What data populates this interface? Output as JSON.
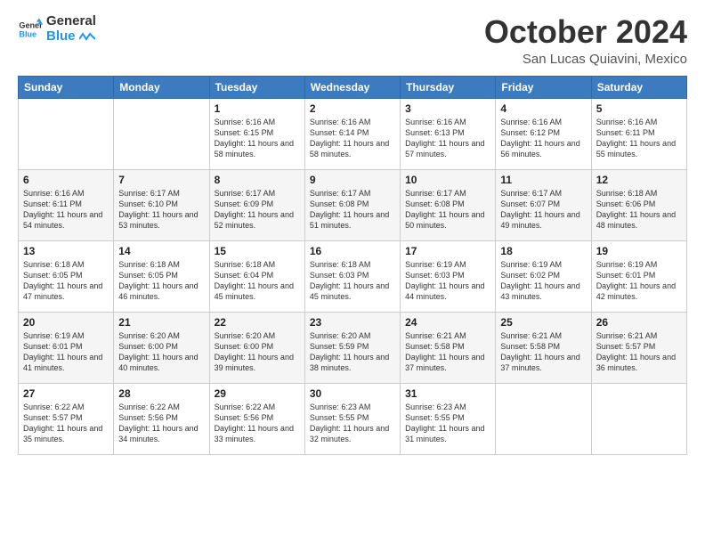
{
  "logo": {
    "text_general": "General",
    "text_blue": "Blue"
  },
  "header": {
    "month": "October 2024",
    "location": "San Lucas Quiavini, Mexico"
  },
  "weekdays": [
    "Sunday",
    "Monday",
    "Tuesday",
    "Wednesday",
    "Thursday",
    "Friday",
    "Saturday"
  ],
  "weeks": [
    [
      {
        "day": "",
        "info": ""
      },
      {
        "day": "",
        "info": ""
      },
      {
        "day": "1",
        "info": "Sunrise: 6:16 AM\nSunset: 6:15 PM\nDaylight: 11 hours and 58 minutes."
      },
      {
        "day": "2",
        "info": "Sunrise: 6:16 AM\nSunset: 6:14 PM\nDaylight: 11 hours and 58 minutes."
      },
      {
        "day": "3",
        "info": "Sunrise: 6:16 AM\nSunset: 6:13 PM\nDaylight: 11 hours and 57 minutes."
      },
      {
        "day": "4",
        "info": "Sunrise: 6:16 AM\nSunset: 6:12 PM\nDaylight: 11 hours and 56 minutes."
      },
      {
        "day": "5",
        "info": "Sunrise: 6:16 AM\nSunset: 6:11 PM\nDaylight: 11 hours and 55 minutes."
      }
    ],
    [
      {
        "day": "6",
        "info": "Sunrise: 6:16 AM\nSunset: 6:11 PM\nDaylight: 11 hours and 54 minutes."
      },
      {
        "day": "7",
        "info": "Sunrise: 6:17 AM\nSunset: 6:10 PM\nDaylight: 11 hours and 53 minutes."
      },
      {
        "day": "8",
        "info": "Sunrise: 6:17 AM\nSunset: 6:09 PM\nDaylight: 11 hours and 52 minutes."
      },
      {
        "day": "9",
        "info": "Sunrise: 6:17 AM\nSunset: 6:08 PM\nDaylight: 11 hours and 51 minutes."
      },
      {
        "day": "10",
        "info": "Sunrise: 6:17 AM\nSunset: 6:08 PM\nDaylight: 11 hours and 50 minutes."
      },
      {
        "day": "11",
        "info": "Sunrise: 6:17 AM\nSunset: 6:07 PM\nDaylight: 11 hours and 49 minutes."
      },
      {
        "day": "12",
        "info": "Sunrise: 6:18 AM\nSunset: 6:06 PM\nDaylight: 11 hours and 48 minutes."
      }
    ],
    [
      {
        "day": "13",
        "info": "Sunrise: 6:18 AM\nSunset: 6:05 PM\nDaylight: 11 hours and 47 minutes."
      },
      {
        "day": "14",
        "info": "Sunrise: 6:18 AM\nSunset: 6:05 PM\nDaylight: 11 hours and 46 minutes."
      },
      {
        "day": "15",
        "info": "Sunrise: 6:18 AM\nSunset: 6:04 PM\nDaylight: 11 hours and 45 minutes."
      },
      {
        "day": "16",
        "info": "Sunrise: 6:18 AM\nSunset: 6:03 PM\nDaylight: 11 hours and 45 minutes."
      },
      {
        "day": "17",
        "info": "Sunrise: 6:19 AM\nSunset: 6:03 PM\nDaylight: 11 hours and 44 minutes."
      },
      {
        "day": "18",
        "info": "Sunrise: 6:19 AM\nSunset: 6:02 PM\nDaylight: 11 hours and 43 minutes."
      },
      {
        "day": "19",
        "info": "Sunrise: 6:19 AM\nSunset: 6:01 PM\nDaylight: 11 hours and 42 minutes."
      }
    ],
    [
      {
        "day": "20",
        "info": "Sunrise: 6:19 AM\nSunset: 6:01 PM\nDaylight: 11 hours and 41 minutes."
      },
      {
        "day": "21",
        "info": "Sunrise: 6:20 AM\nSunset: 6:00 PM\nDaylight: 11 hours and 40 minutes."
      },
      {
        "day": "22",
        "info": "Sunrise: 6:20 AM\nSunset: 6:00 PM\nDaylight: 11 hours and 39 minutes."
      },
      {
        "day": "23",
        "info": "Sunrise: 6:20 AM\nSunset: 5:59 PM\nDaylight: 11 hours and 38 minutes."
      },
      {
        "day": "24",
        "info": "Sunrise: 6:21 AM\nSunset: 5:58 PM\nDaylight: 11 hours and 37 minutes."
      },
      {
        "day": "25",
        "info": "Sunrise: 6:21 AM\nSunset: 5:58 PM\nDaylight: 11 hours and 37 minutes."
      },
      {
        "day": "26",
        "info": "Sunrise: 6:21 AM\nSunset: 5:57 PM\nDaylight: 11 hours and 36 minutes."
      }
    ],
    [
      {
        "day": "27",
        "info": "Sunrise: 6:22 AM\nSunset: 5:57 PM\nDaylight: 11 hours and 35 minutes."
      },
      {
        "day": "28",
        "info": "Sunrise: 6:22 AM\nSunset: 5:56 PM\nDaylight: 11 hours and 34 minutes."
      },
      {
        "day": "29",
        "info": "Sunrise: 6:22 AM\nSunset: 5:56 PM\nDaylight: 11 hours and 33 minutes."
      },
      {
        "day": "30",
        "info": "Sunrise: 6:23 AM\nSunset: 5:55 PM\nDaylight: 11 hours and 32 minutes."
      },
      {
        "day": "31",
        "info": "Sunrise: 6:23 AM\nSunset: 5:55 PM\nDaylight: 11 hours and 31 minutes."
      },
      {
        "day": "",
        "info": ""
      },
      {
        "day": "",
        "info": ""
      }
    ]
  ]
}
